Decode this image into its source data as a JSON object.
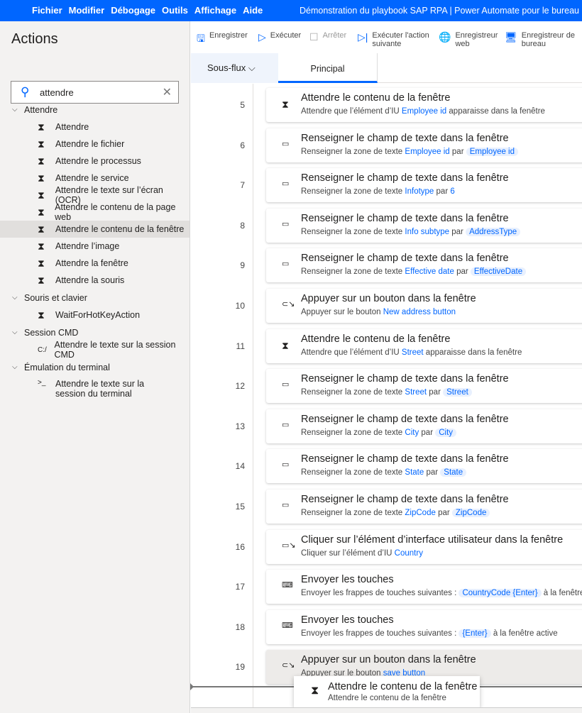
{
  "menu": [
    "Fichier",
    "Modifier",
    "Débogage",
    "Outils",
    "Affichage",
    "Aide"
  ],
  "window_title": "Démonstration du playbook SAP RPA | Power Automate pour le bureau",
  "sidebar": {
    "title": "Actions",
    "search_value": "attendre",
    "groups": [
      {
        "label": "Attendre",
        "items": [
          {
            "label": "Attendre",
            "icon": "hourglass-icon"
          },
          {
            "label": "Attendre le fichier",
            "icon": "hourglass-icon"
          },
          {
            "label": "Attendre le processus",
            "icon": "hourglass-icon"
          },
          {
            "label": "Attendre le service",
            "icon": "hourglass-icon"
          },
          {
            "label": "Attendre le texte sur l’écran (OCR)",
            "icon": "hourglass-icon"
          },
          {
            "label": "Attendre le contenu de la page web",
            "icon": "hourglass-icon"
          },
          {
            "label": "Attendre le contenu de la fenêtre",
            "icon": "hourglass-icon",
            "selected": true
          },
          {
            "label": "Attendre l’image",
            "icon": "hourglass-icon"
          },
          {
            "label": "Attendre la fenêtre",
            "icon": "hourglass-icon"
          },
          {
            "label": "Attendre la souris",
            "icon": "hourglass-icon"
          }
        ]
      },
      {
        "label": "Souris et clavier",
        "items": [
          {
            "label": "WaitForHotKeyAction",
            "icon": "hourglass-icon"
          }
        ]
      },
      {
        "label": "Session CMD",
        "items": [
          {
            "label": "Attendre le texte sur la session CMD",
            "icon": "cmd-icon"
          }
        ]
      },
      {
        "label": "Émulation du terminal",
        "items": [
          {
            "label": "Attendre le texte sur la session du terminal",
            "icon": "terminal-icon"
          }
        ]
      }
    ]
  },
  "toolbar": {
    "save": "Enregistrer",
    "run": "Exécuter",
    "stop": "Arrêter",
    "next": "Exécuter l'action suivante",
    "web_recorder": "Enregistreur web",
    "desktop_recorder": "Enregistreur de bureau"
  },
  "tabs": {
    "subflows": "Sous-flux",
    "main": "Principal"
  },
  "steps": [
    {
      "n": "5",
      "icon": "hourglass-icon",
      "title": "Attendre le contenu de la fenêtre",
      "sub": [
        {
          "t": "Attendre que l’élément d’IU "
        },
        {
          "v": "Employee id",
          "plain": true
        },
        {
          "t": " apparaisse dans la fenêtre"
        }
      ]
    },
    {
      "n": "6",
      "icon": "textbox-icon",
      "title": "Renseigner le champ de texte dans la fenêtre",
      "sub": [
        {
          "t": "Renseigner la zone de texte "
        },
        {
          "v": "Employee id",
          "plain": true
        },
        {
          "t": " par "
        },
        {
          "v": "Employee id"
        }
      ]
    },
    {
      "n": "7",
      "icon": "textbox-icon",
      "title": "Renseigner le champ de texte dans la fenêtre",
      "sub": [
        {
          "t": "Renseigner la zone de texte "
        },
        {
          "v": "Infotype",
          "plain": true
        },
        {
          "t": " par "
        },
        {
          "v": "6",
          "plain": true
        }
      ]
    },
    {
      "n": "8",
      "icon": "textbox-icon",
      "title": "Renseigner le champ de texte dans la fenêtre",
      "sub": [
        {
          "t": "Renseigner la zone de texte "
        },
        {
          "v": "Info subtype",
          "plain": true
        },
        {
          "t": " par "
        },
        {
          "v": "AddressType"
        }
      ]
    },
    {
      "n": "9",
      "icon": "textbox-icon",
      "title": "Renseigner le champ de texte dans la fenêtre",
      "sub": [
        {
          "t": "Renseigner la zone de texte "
        },
        {
          "v": "Effective date",
          "plain": true
        },
        {
          "t": " par "
        },
        {
          "v": "EffectiveDate"
        }
      ]
    },
    {
      "n": "10",
      "icon": "press-button-icon",
      "title": "Appuyer sur un bouton dans la fenêtre",
      "sub": [
        {
          "t": "Appuyer sur le bouton "
        },
        {
          "v": "New address button",
          "plain": true
        }
      ]
    },
    {
      "n": "11",
      "icon": "hourglass-icon",
      "title": "Attendre le contenu de la fenêtre",
      "sub": [
        {
          "t": "Attendre que l’élément d’IU "
        },
        {
          "v": "Street",
          "plain": true
        },
        {
          "t": " apparaisse dans la fenêtre"
        }
      ]
    },
    {
      "n": "12",
      "icon": "textbox-icon",
      "title": "Renseigner le champ de texte dans la fenêtre",
      "sub": [
        {
          "t": "Renseigner la zone de texte "
        },
        {
          "v": "Street",
          "plain": true
        },
        {
          "t": " par "
        },
        {
          "v": "Street"
        }
      ]
    },
    {
      "n": "13",
      "icon": "textbox-icon",
      "title": "Renseigner le champ de texte dans la fenêtre",
      "sub": [
        {
          "t": "Renseigner la zone de texte "
        },
        {
          "v": "City",
          "plain": true
        },
        {
          "t": " par "
        },
        {
          "v": "City"
        }
      ]
    },
    {
      "n": "14",
      "icon": "textbox-icon",
      "title": "Renseigner le champ de texte dans la fenêtre",
      "sub": [
        {
          "t": "Renseigner la zone de texte "
        },
        {
          "v": "State",
          "plain": true
        },
        {
          "t": " par "
        },
        {
          "v": "State"
        }
      ]
    },
    {
      "n": "15",
      "icon": "textbox-icon",
      "title": "Renseigner le champ de texte dans la fenêtre",
      "sub": [
        {
          "t": "Renseigner la zone de texte "
        },
        {
          "v": "ZipCode",
          "plain": true
        },
        {
          "t": " par "
        },
        {
          "v": "ZipCode"
        }
      ]
    },
    {
      "n": "16",
      "icon": "click-element-icon",
      "title": "Cliquer sur l’élément d’interface utilisateur dans la fenêtre",
      "sub": [
        {
          "t": "Cliquer sur l’élément d’IU "
        },
        {
          "v": "Country",
          "plain": true
        }
      ]
    },
    {
      "n": "17",
      "icon": "keyboard-icon",
      "title": "Envoyer les touches",
      "sub": [
        {
          "t": "Envoyer les frappes de touches suivantes : "
        },
        {
          "v": "CountryCode {Enter}"
        },
        {
          "t": " à la fenêtre active"
        }
      ]
    },
    {
      "n": "18",
      "icon": "keyboard-icon",
      "title": "Envoyer les touches",
      "sub": [
        {
          "t": "Envoyer les frappes de touches suivantes : "
        },
        {
          "v": "{Enter}"
        },
        {
          "t": " à la fenêtre active"
        }
      ]
    },
    {
      "n": "19",
      "icon": "press-button-icon",
      "title": "Appuyer sur un bouton dans la fenêtre",
      "highlight": true,
      "sub": [
        {
          "t": "Appuyer sur le bouton "
        },
        {
          "v": "save button",
          "plain": true
        }
      ]
    }
  ],
  "drag_ghost": {
    "title": "Attendre le contenu de la fenêtre",
    "subtitle": "Attendre le contenu de la fenêtre"
  }
}
